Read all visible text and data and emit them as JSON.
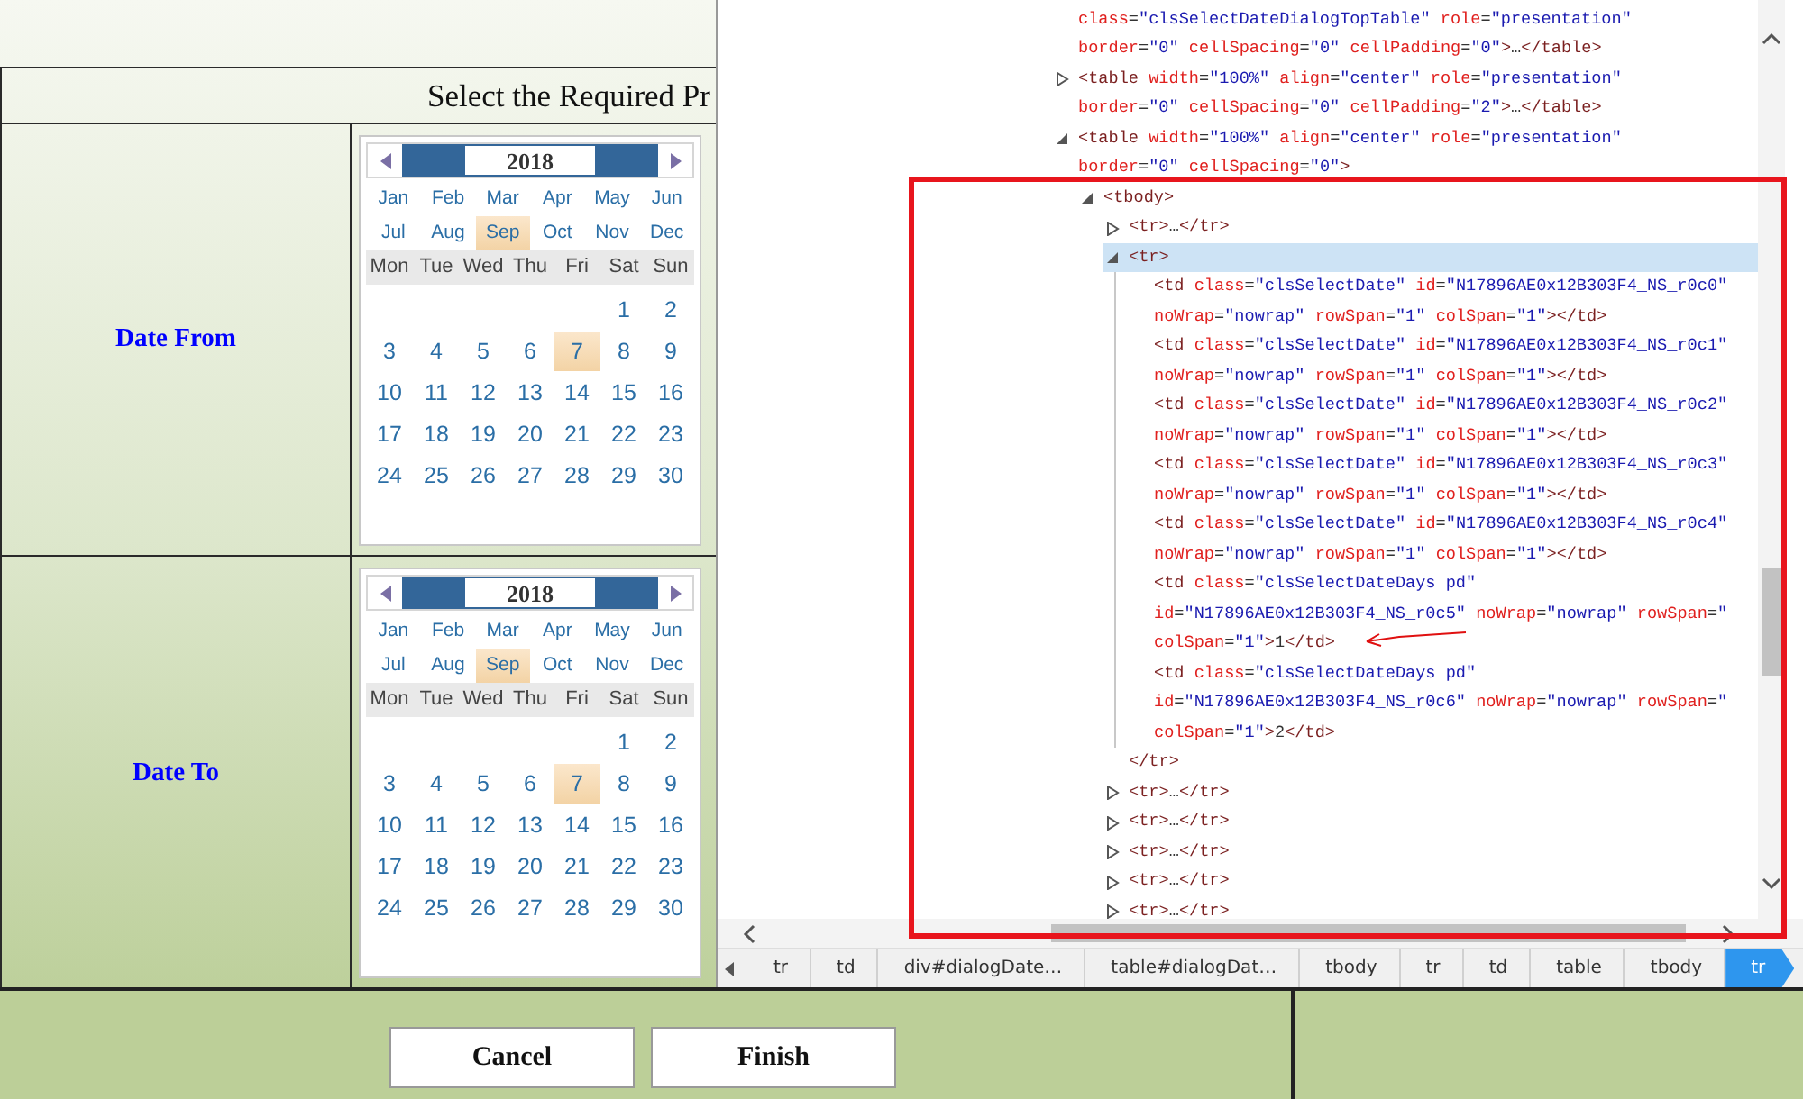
{
  "page": {
    "header": "Select the Required Pr",
    "rows": [
      {
        "label": "Date From",
        "calendar": {
          "year": "2018",
          "months": [
            {
              "label": "Jan",
              "selected": false
            },
            {
              "label": "Feb",
              "selected": false
            },
            {
              "label": "Mar",
              "selected": false
            },
            {
              "label": "Apr",
              "selected": false
            },
            {
              "label": "May",
              "selected": false
            },
            {
              "label": "Jun",
              "selected": false
            },
            {
              "label": "Jul",
              "selected": false
            },
            {
              "label": "Aug",
              "selected": false
            },
            {
              "label": "Sep",
              "selected": true
            },
            {
              "label": "Oct",
              "selected": false
            },
            {
              "label": "Nov",
              "selected": false
            },
            {
              "label": "Dec",
              "selected": false
            }
          ],
          "weekdays": [
            "Mon",
            "Tue",
            "Wed",
            "Thu",
            "Fri",
            "Sat",
            "Sun"
          ],
          "weeks": [
            [
              {
                "day": "1",
                "selected": false
              },
              {
                "day": "2",
                "selected": false
              }
            ],
            [
              {
                "day": "3",
                "selected": false
              },
              {
                "day": "4",
                "selected": false
              },
              {
                "day": "5",
                "selected": false
              },
              {
                "day": "6",
                "selected": false
              },
              {
                "day": "7",
                "selected": true
              },
              {
                "day": "8",
                "selected": false
              },
              {
                "day": "9",
                "selected": false
              }
            ],
            [
              {
                "day": "10",
                "selected": false
              },
              {
                "day": "11",
                "selected": false
              },
              {
                "day": "12",
                "selected": false
              },
              {
                "day": "13",
                "selected": false
              },
              {
                "day": "14",
                "selected": false
              },
              {
                "day": "15",
                "selected": false
              },
              {
                "day": "16",
                "selected": false
              }
            ],
            [
              {
                "day": "17",
                "selected": false
              },
              {
                "day": "18",
                "selected": false
              },
              {
                "day": "19",
                "selected": false
              },
              {
                "day": "20",
                "selected": false
              },
              {
                "day": "21",
                "selected": false
              },
              {
                "day": "22",
                "selected": false
              },
              {
                "day": "23",
                "selected": false
              }
            ],
            [
              {
                "day": "24",
                "selected": false
              },
              {
                "day": "25",
                "selected": false
              },
              {
                "day": "26",
                "selected": false
              },
              {
                "day": "27",
                "selected": false
              },
              {
                "day": "28",
                "selected": false
              },
              {
                "day": "29",
                "selected": false
              },
              {
                "day": "30",
                "selected": false
              }
            ]
          ]
        }
      },
      {
        "label": "Date To",
        "calendar": {
          "year": "2018",
          "months": [
            {
              "label": "Jan",
              "selected": false
            },
            {
              "label": "Feb",
              "selected": false
            },
            {
              "label": "Mar",
              "selected": false
            },
            {
              "label": "Apr",
              "selected": false
            },
            {
              "label": "May",
              "selected": false
            },
            {
              "label": "Jun",
              "selected": false
            },
            {
              "label": "Jul",
              "selected": false
            },
            {
              "label": "Aug",
              "selected": false
            },
            {
              "label": "Sep",
              "selected": true
            },
            {
              "label": "Oct",
              "selected": false
            },
            {
              "label": "Nov",
              "selected": false
            },
            {
              "label": "Dec",
              "selected": false
            }
          ],
          "weekdays": [
            "Mon",
            "Tue",
            "Wed",
            "Thu",
            "Fri",
            "Sat",
            "Sun"
          ],
          "weeks": [
            [
              {
                "day": "1",
                "selected": false
              },
              {
                "day": "2",
                "selected": false
              }
            ],
            [
              {
                "day": "3",
                "selected": false
              },
              {
                "day": "4",
                "selected": false
              },
              {
                "day": "5",
                "selected": false
              },
              {
                "day": "6",
                "selected": false
              },
              {
                "day": "7",
                "selected": true
              },
              {
                "day": "8",
                "selected": false
              },
              {
                "day": "9",
                "selected": false
              }
            ],
            [
              {
                "day": "10",
                "selected": false
              },
              {
                "day": "11",
                "selected": false
              },
              {
                "day": "12",
                "selected": false
              },
              {
                "day": "13",
                "selected": false
              },
              {
                "day": "14",
                "selected": false
              },
              {
                "day": "15",
                "selected": false
              },
              {
                "day": "16",
                "selected": false
              }
            ],
            [
              {
                "day": "17",
                "selected": false
              },
              {
                "day": "18",
                "selected": false
              },
              {
                "day": "19",
                "selected": false
              },
              {
                "day": "20",
                "selected": false
              },
              {
                "day": "21",
                "selected": false
              },
              {
                "day": "22",
                "selected": false
              },
              {
                "day": "23",
                "selected": false
              }
            ],
            [
              {
                "day": "24",
                "selected": false
              },
              {
                "day": "25",
                "selected": false
              },
              {
                "day": "26",
                "selected": false
              },
              {
                "day": "27",
                "selected": false
              },
              {
                "day": "28",
                "selected": false
              },
              {
                "day": "29",
                "selected": false
              },
              {
                "day": "30",
                "selected": false
              }
            ]
          ]
        }
      }
    ],
    "buttons": [
      "Cancel",
      "Finish"
    ]
  },
  "devtools": {
    "dom_tree": [
      {
        "lines": [
          "class=\"clsSelectDateDialogTopTable\" role=\"presentation\"",
          "border=\"0\" cellSpacing=\"0\" cellPadding=\"0\">…</table>"
        ],
        "selected": false
      },
      {
        "lines": [
          "<table width=\"100%\" align=\"center\" role=\"presentation\"",
          "border=\"0\" cellSpacing=\"0\" cellPadding=\"2\">…</table>"
        ],
        "expanded": false,
        "selected": false
      },
      {
        "lines": [
          "<table width=\"100%\" align=\"center\" role=\"presentation\"",
          "border=\"0\" cellSpacing=\"0\">"
        ],
        "expanded": true,
        "selected": false,
        "children": [
          {
            "lines": [
              "<tbody>"
            ],
            "expanded": true,
            "selected": false,
            "children": [
              {
                "lines": [
                  "<tr>…</tr>"
                ],
                "expanded": false,
                "selected": false
              },
              {
                "lines": [
                  "<tr>"
                ],
                "expanded": true,
                "selected": true,
                "closing": "</tr>",
                "children": [
                  {
                    "lines": [
                      "<td class=\"clsSelectDate\" id=\"N17896AE0x12B303F4_NS_r0c0\"",
                      "noWrap=\"nowrap\" rowSpan=\"1\" colSpan=\"1\"></td>"
                    ],
                    "selected": false
                  },
                  {
                    "lines": [
                      "<td class=\"clsSelectDate\" id=\"N17896AE0x12B303F4_NS_r0c1\"",
                      "noWrap=\"nowrap\" rowSpan=\"1\" colSpan=\"1\"></td>"
                    ],
                    "selected": false
                  },
                  {
                    "lines": [
                      "<td class=\"clsSelectDate\" id=\"N17896AE0x12B303F4_NS_r0c2\"",
                      "noWrap=\"nowrap\" rowSpan=\"1\" colSpan=\"1\"></td>"
                    ],
                    "selected": false
                  },
                  {
                    "lines": [
                      "<td class=\"clsSelectDate\" id=\"N17896AE0x12B303F4_NS_r0c3\"",
                      "noWrap=\"nowrap\" rowSpan=\"1\" colSpan=\"1\"></td>"
                    ],
                    "selected": false
                  },
                  {
                    "lines": [
                      "<td class=\"clsSelectDate\" id=\"N17896AE0x12B303F4_NS_r0c4\"",
                      "noWrap=\"nowrap\" rowSpan=\"1\" colSpan=\"1\"></td>"
                    ],
                    "selected": false
                  },
                  {
                    "lines": [
                      "<td class=\"clsSelectDateDays pd\"",
                      "id=\"N17896AE0x12B303F4_NS_r0c5\" noWrap=\"nowrap\" rowSpan=\"",
                      "colSpan=\"1\">1</td>"
                    ],
                    "selected": false
                  },
                  {
                    "lines": [
                      "<td class=\"clsSelectDateDays pd\"",
                      "id=\"N17896AE0x12B303F4_NS_r0c6\" noWrap=\"nowrap\" rowSpan=\"",
                      "colSpan=\"1\">2</td>"
                    ],
                    "selected": false
                  }
                ]
              },
              {
                "lines": [
                  "<tr>…</tr>"
                ],
                "expanded": false,
                "selected": false
              },
              {
                "lines": [
                  "<tr>…</tr>"
                ],
                "expanded": false,
                "selected": false
              },
              {
                "lines": [
                  "<tr>…</tr>"
                ],
                "expanded": false,
                "selected": false
              },
              {
                "lines": [
                  "<tr>…</tr>"
                ],
                "expanded": false,
                "selected": false
              },
              {
                "lines": [
                  "<tr>…</tr>"
                ],
                "expanded": false,
                "selected": false
              }
            ]
          }
        ]
      }
    ],
    "breadcrumbs": [
      {
        "label": "tr",
        "selected": false
      },
      {
        "label": "td",
        "selected": false
      },
      {
        "label": "div#dialogDate…",
        "selected": false
      },
      {
        "label": "table#dialogDat…",
        "selected": false
      },
      {
        "label": "tbody",
        "selected": false
      },
      {
        "label": "tr",
        "selected": false
      },
      {
        "label": "td",
        "selected": false
      },
      {
        "label": "table",
        "selected": false
      },
      {
        "label": "tbody",
        "selected": false
      },
      {
        "label": "tr",
        "selected": true
      }
    ]
  }
}
